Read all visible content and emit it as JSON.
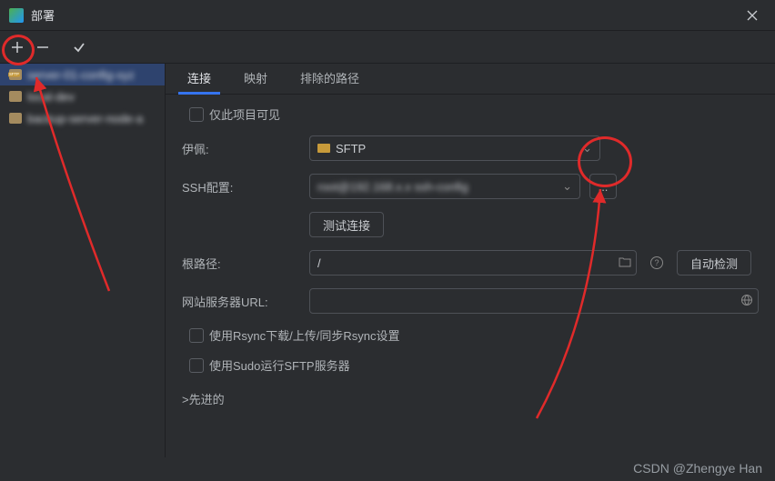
{
  "window": {
    "title": "部署"
  },
  "sidebar": {
    "items": [
      {
        "label": "server-01-config-xyz"
      },
      {
        "label": "local-dev"
      },
      {
        "label": "backup-server-node-a"
      }
    ]
  },
  "tabs": [
    {
      "label": "连接",
      "active": true
    },
    {
      "label": "映射",
      "active": false
    },
    {
      "label": "排除的路径",
      "active": false
    }
  ],
  "form": {
    "visible_only_label": "仅此项目可见",
    "name_label": "伊佩:",
    "type_value": "SFTP",
    "ssh_label": "SSH配置:",
    "ssh_value": "root@192.168.x.x  ssh-config",
    "ssh_more": "...",
    "test_button": "测试连接",
    "root_label": "根路径:",
    "root_value": "/",
    "autodetect": "自动检测",
    "url_label": "网站服务器URL:",
    "url_value": "",
    "rsync_label": "使用Rsync下载/上传/同步Rsync设置",
    "sudo_label": "使用Sudo运行SFTP服务器",
    "advanced": ">先进的"
  },
  "watermark": "CSDN @Zhengye Han"
}
